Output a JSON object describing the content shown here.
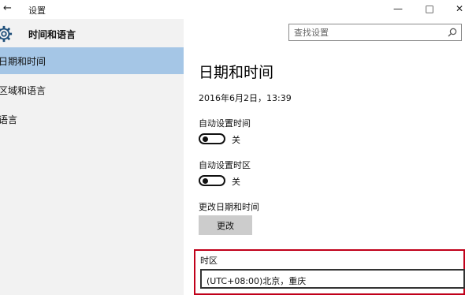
{
  "window": {
    "title": "设置",
    "back_icon": "arrow-left-icon",
    "minimize_icon": "minimize-icon",
    "maximize_icon": "maximize-icon",
    "close_icon": "close-icon"
  },
  "search": {
    "placeholder": "查找设置",
    "value": "",
    "icon": "search-icon"
  },
  "sidebar": {
    "header": {
      "icon": "gear-icon",
      "title": "时间和语言"
    },
    "items": [
      {
        "label": "日期和时间",
        "active": true
      },
      {
        "label": "区域和语言",
        "active": false
      },
      {
        "label": "语言",
        "active": false
      }
    ]
  },
  "main": {
    "title": "日期和时间",
    "current_datetime": "2016年6月2日，13:39",
    "auto_time": {
      "label": "自动设置时间",
      "state": "关",
      "on": false
    },
    "auto_timezone": {
      "label": "自动设置时区",
      "state": "关",
      "on": false
    },
    "change_datetime": {
      "label": "更改日期和时间",
      "button": "更改"
    },
    "timezone": {
      "label": "时区",
      "value": "(UTC+08:00)北京，重庆"
    }
  },
  "colors": {
    "sidebar_bg": "#f2f2f2",
    "active_item": "#a5c6e6",
    "highlight_border": "#c0001a",
    "button_bg": "#cccccc"
  }
}
